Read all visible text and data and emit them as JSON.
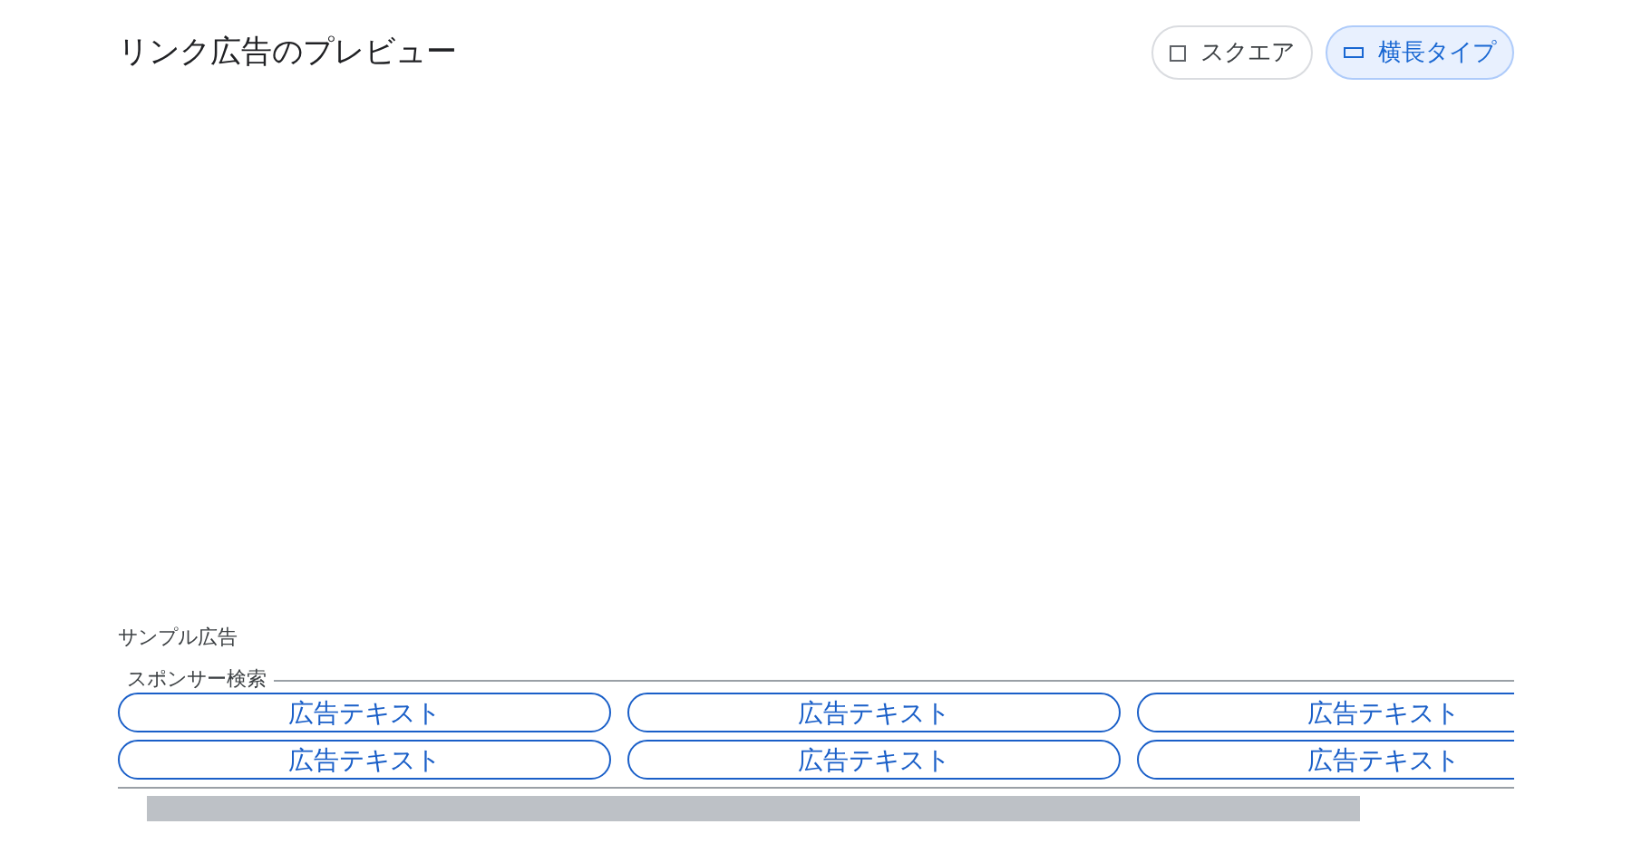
{
  "title": "リンク広告のプレビュー",
  "formats": [
    {
      "label": "スクエア",
      "kind": "square",
      "selected": false
    },
    {
      "label": "横長タイプ",
      "kind": "wide",
      "selected": true
    }
  ],
  "sample_label": "サンプル広告",
  "ad": {
    "legend": "スポンサー検索",
    "links": [
      "広告テキスト",
      "広告テキスト",
      "広告テキスト",
      "広告テキスト",
      "広告テキスト",
      "広告テキスト"
    ]
  }
}
